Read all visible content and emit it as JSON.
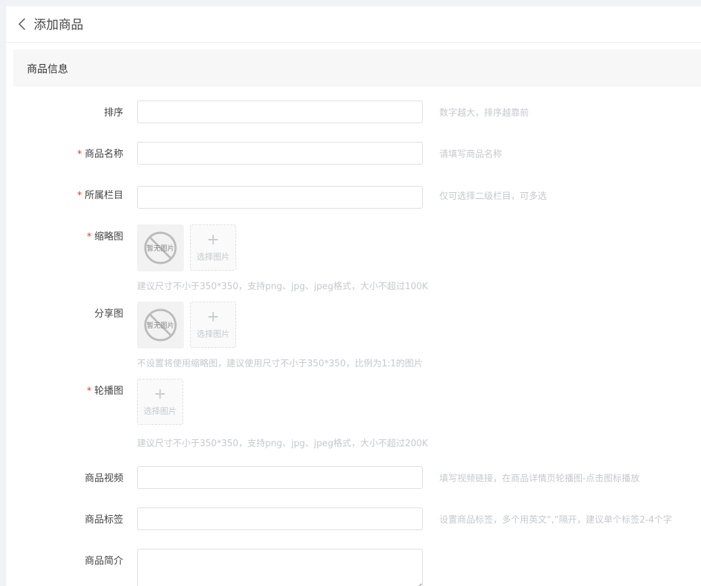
{
  "header": {
    "title": "添加商品"
  },
  "section": {
    "title": "商品信息"
  },
  "fields": {
    "sort": {
      "label": "排序",
      "required": false,
      "tip": "数字越大，排序越靠前",
      "value": ""
    },
    "name": {
      "label": "商品名称",
      "required": true,
      "tip": "请填写商品名称",
      "value": ""
    },
    "category": {
      "label": "所属栏目",
      "required": true,
      "tip": "仅可选择二级栏目，可多选",
      "value": ""
    },
    "thumbnail": {
      "label": "缩略图",
      "required": true,
      "placeholder_text": "暂无图片",
      "upload_label": "选择图片",
      "hint": "建议尺寸不小于350*350，支持png、jpg、jpeg格式，大小不超过100K"
    },
    "share_image": {
      "label": "分享图",
      "required": false,
      "placeholder_text": "暂无图片",
      "upload_label": "选择图片",
      "hint": "不设置将使用缩略图，建议使用尺寸不小于350*350，比例为1:1的图片"
    },
    "carousel": {
      "label": "轮播图",
      "required": true,
      "upload_label": "选择图片",
      "hint": "建议尺寸不小于350*350，支持png、jpg、jpeg格式，大小不超过200K"
    },
    "video": {
      "label": "商品视频",
      "required": false,
      "tip": "填写视频链接，在商品详情页轮播图-点击图标播放",
      "value": ""
    },
    "tags": {
      "label": "商品标签",
      "required": false,
      "tip": "设置商品标签，多个用英文“,”隔开，建议单个标签2-4个字",
      "value": ""
    },
    "summary": {
      "label": "商品简介",
      "required": false,
      "value": ""
    }
  },
  "colors": {
    "required_mark": "#ed4014",
    "hint": "#c5c8ce",
    "border": "#dcdee2"
  },
  "icons": {
    "back": "chevron-left-icon",
    "no_image": "no-image-icon",
    "plus": "plus-icon"
  }
}
